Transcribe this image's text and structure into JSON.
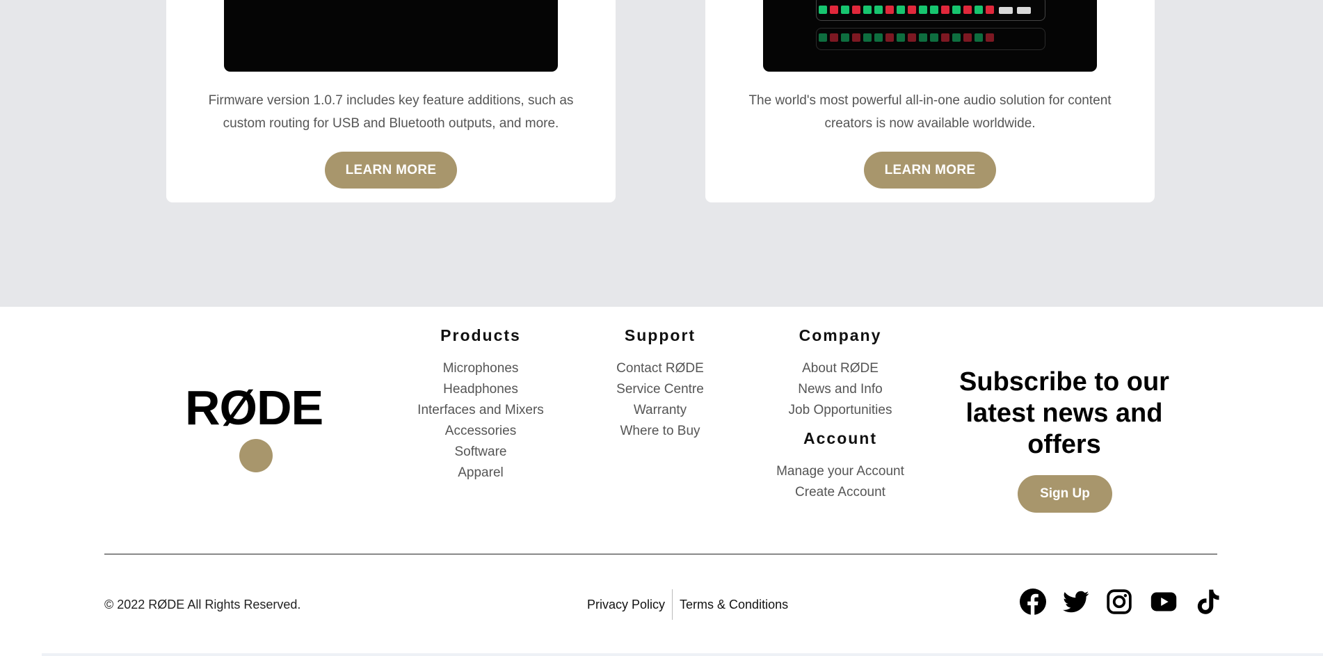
{
  "cards": [
    {
      "description": "Firmware version 1.0.7 includes key feature additions, such as custom routing for USB and Bluetooth outputs, and more.",
      "button_label": "LEARN MORE"
    },
    {
      "description": "The world's most powerful all-in-one audio solution for content creators is now available worldwide.",
      "button_label": "LEARN MORE"
    }
  ],
  "footer": {
    "logo_text": "RØDE",
    "columns": {
      "products": {
        "heading": "Products",
        "links": [
          "Microphones",
          "Headphones",
          "Interfaces and Mixers",
          "Accessories",
          "Software",
          "Apparel"
        ]
      },
      "support": {
        "heading": "Support",
        "links": [
          "Contact RØDE",
          "Service Centre",
          "Warranty",
          "Where to Buy"
        ]
      },
      "company": {
        "heading": "Company",
        "links": [
          "About RØDE",
          "News and Info",
          "Job Opportunities"
        ]
      },
      "account": {
        "heading": "Account",
        "links": [
          "Manage your Account",
          "Create Account"
        ]
      }
    },
    "subscribe": {
      "title": "Subscribe to our latest news and offers",
      "button_label": "Sign Up"
    },
    "copyright": "© 2022 RØDE All Rights Reserved.",
    "legal": {
      "privacy": "Privacy Policy",
      "terms": "Terms & Conditions"
    },
    "socials": [
      "facebook-icon",
      "twitter-icon",
      "instagram-icon",
      "youtube-icon",
      "tiktok-icon"
    ]
  },
  "colors": {
    "accent": "#a8966c",
    "section_bg": "#e6e7ea"
  }
}
